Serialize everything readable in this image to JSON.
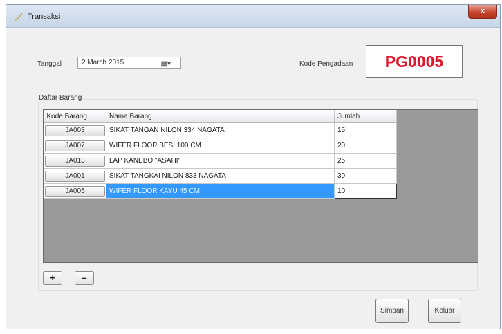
{
  "window": {
    "title": "Transaksi",
    "close_label": "x"
  },
  "form": {
    "tanggal_label": "Tanggal",
    "tanggal_value": "2  March  2015",
    "kode_label": "Kode Pengadaan",
    "kode_value": "PG0005"
  },
  "group": {
    "title": "Daftar Barang"
  },
  "table": {
    "headers": [
      "Kode Barang",
      "Nama Barang",
      "Jumlah"
    ],
    "rows": [
      {
        "kode": "JA003",
        "nama": "SIKAT TANGAN NILON 334 NAGATA",
        "jumlah": "15"
      },
      {
        "kode": "JA007",
        "nama": "WIFER FLOOR BESI 100 CM",
        "jumlah": "20"
      },
      {
        "kode": "JA013",
        "nama": "LAP KANEBO \"ASAHI\"",
        "jumlah": "25"
      },
      {
        "kode": "JA001",
        "nama": "SIKAT TANGKAI NILON 833 NAGATA",
        "jumlah": "30"
      },
      {
        "kode": "JA005",
        "nama": "WIFER FLOOR KAYU 45 CM",
        "jumlah": "10"
      }
    ],
    "selected_row": 4
  },
  "buttons": {
    "add": "+",
    "remove": "–",
    "simpan": "Simpan",
    "keluar": "Keluar"
  }
}
